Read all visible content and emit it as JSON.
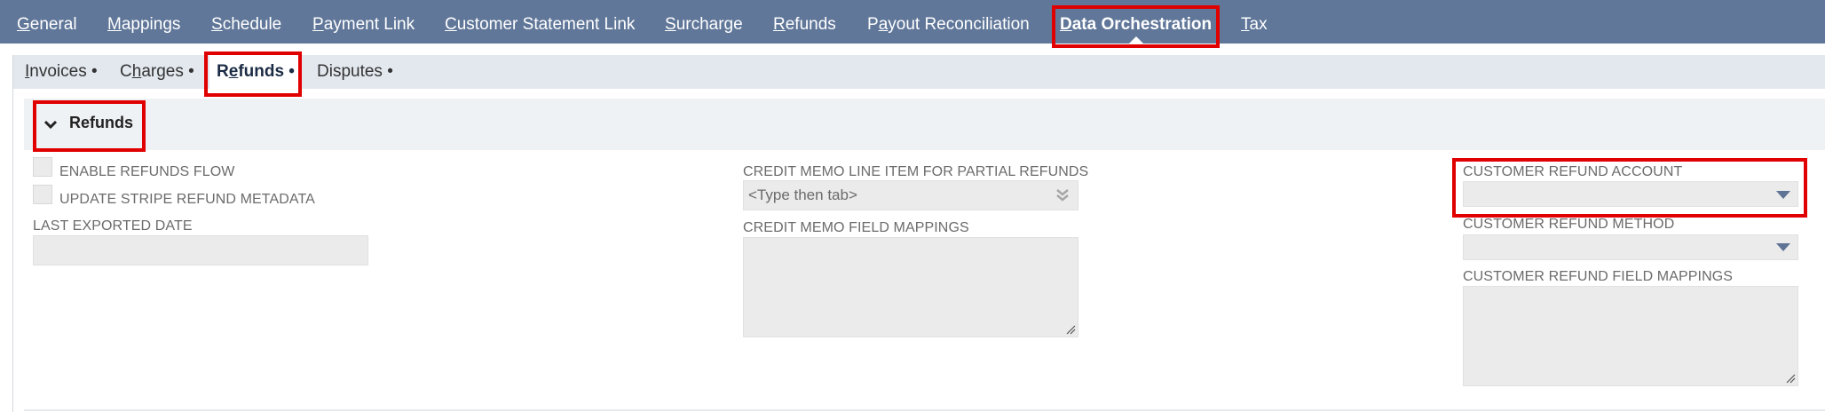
{
  "top_tabs": [
    {
      "first": "G",
      "rest": "eneral"
    },
    {
      "first": "M",
      "rest": "appings"
    },
    {
      "first": "S",
      "rest": "chedule"
    },
    {
      "first": "P",
      "rest": "ayment Link"
    },
    {
      "first": "C",
      "rest": "ustomer Statement Link"
    },
    {
      "first": "S",
      "rest": "urcharge",
      "pre": ""
    },
    {
      "first": "R",
      "rest": "efunds"
    },
    {
      "pre": "P",
      "first": "a",
      "rest": "yout Reconciliation"
    },
    {
      "first": "D",
      "rest": "ata Orchestration"
    },
    {
      "first": "T",
      "rest": "ax"
    }
  ],
  "sub_tabs": [
    {
      "first": "I",
      "pre": "",
      "rest": "nvoices •"
    },
    {
      "pre": "C",
      "first": "h",
      "rest": "arges •"
    },
    {
      "pre": "R",
      "first": "e",
      "rest": "funds •"
    },
    {
      "pre": "Disputes •",
      "first": "",
      "rest": ""
    }
  ],
  "section": {
    "title": "Refunds"
  },
  "fields": {
    "enable_refunds_flow": "ENABLE REFUNDS FLOW",
    "update_stripe_refund_metadata": "UPDATE STRIPE REFUND METADATA",
    "last_exported_date": "LAST EXPORTED DATE",
    "credit_memo_line_item": "CREDIT MEMO LINE ITEM FOR PARTIAL REFUNDS",
    "credit_memo_line_item_placeholder": "<Type then tab>",
    "credit_memo_field_mappings": "CREDIT MEMO FIELD MAPPINGS",
    "customer_refund_account": "CUSTOMER REFUND ACCOUNT",
    "customer_refund_method": "CUSTOMER REFUND METHOD",
    "customer_refund_field_mappings": "CUSTOMER REFUND FIELD MAPPINGS"
  },
  "colors": {
    "topbar": "#607799",
    "subbar": "#e3e8ef",
    "highlight": "#e00000"
  }
}
